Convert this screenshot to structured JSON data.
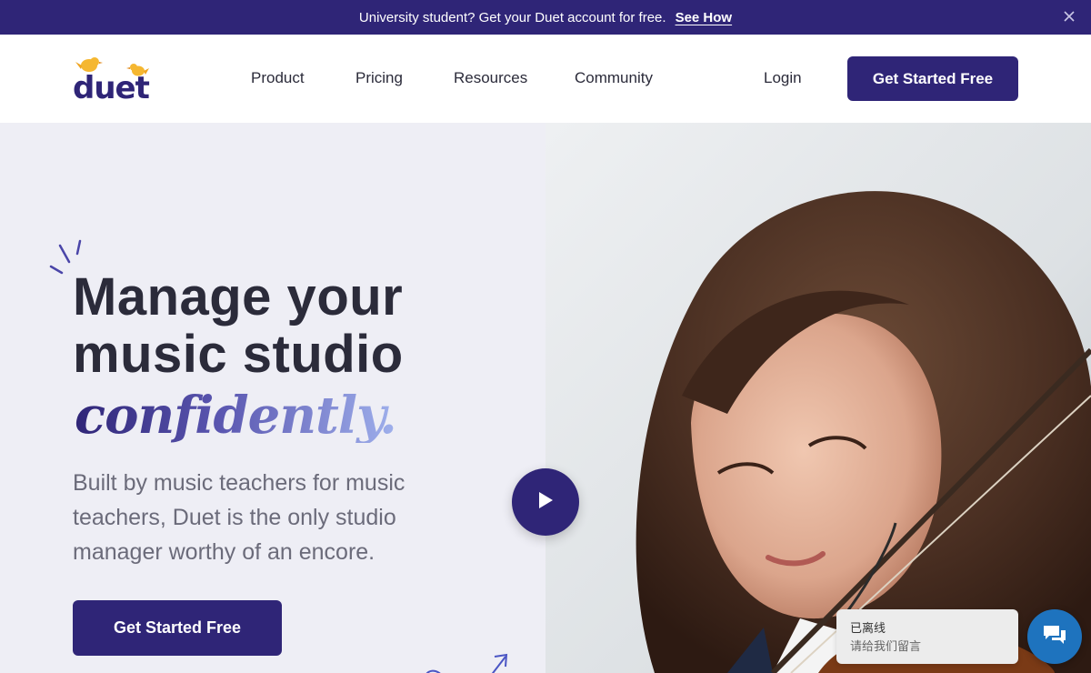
{
  "announcement": {
    "message": "University student? Get your Duet account for free.",
    "link": "See How",
    "close_icon": "close-icon"
  },
  "header": {
    "logo_text": "duet",
    "nav": {
      "product": "Product",
      "pricing": "Pricing",
      "resources": "Resources",
      "community": "Community"
    },
    "login": "Login",
    "cta": "Get Started Free"
  },
  "hero": {
    "headline_line1": "Manage your",
    "headline_line2": "music studio",
    "headline_emphasis": "confidently.",
    "subtitle": "Built by music teachers for music teachers, Duet is the only studio manager worthy of an encore.",
    "cta": "Get Started Free",
    "play_icon": "play-icon"
  },
  "chat": {
    "status": "已离线",
    "prompt": "请给我们留言",
    "icon": "chat-icon"
  },
  "colors": {
    "brand": "#2f2577",
    "hero_bg": "#eeeef5",
    "logo_yellow": "#f5b731",
    "chat_blue": "#1e73be"
  }
}
